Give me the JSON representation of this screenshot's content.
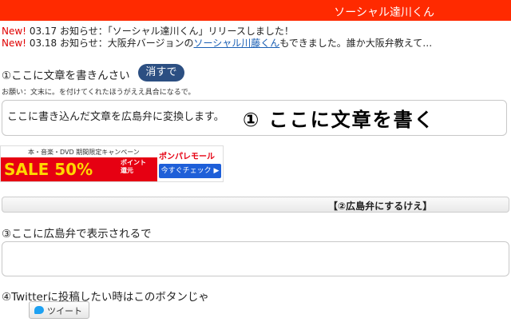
{
  "header": {
    "title": "ソーシャル達川くん"
  },
  "news": [
    {
      "badge": "New!",
      "text": "03.17 お知らせ：「ソーシャル達川くん」リリースしました！"
    },
    {
      "badge": "New!",
      "text_before": "03.18 お知らせ：大阪弁バージョンの",
      "link": "ソーシャル川藤くん",
      "text_after": "もできました。誰か大阪弁教えて…"
    }
  ],
  "input_section": {
    "title": "①ここに文章を書きんさい",
    "clear_button": "消すで",
    "note": "お願い：文末に。を付けてくれたほうがええ具合になるで。",
    "input_value": "ここに書き込んだ文章を広島弁に変換します。",
    "overlay_text": "① ここに文章を書く"
  },
  "ad": {
    "top_text": "本・音楽・DVD 期間限定キャンペーン",
    "sale_text": "SALE 50%",
    "sale_sub": "ポイント還元",
    "logo": "ポンパレモール",
    "button": "今すぐチェック ▶"
  },
  "convert": {
    "button": "【②広島弁にするけえ】"
  },
  "output_section": {
    "title": "③ここに広島弁で表示されるで",
    "value": ""
  },
  "tweet_section": {
    "title": "④Twitterに投稿したい時はこのボタンじゃ",
    "button": "ツイート"
  },
  "colors": {
    "header_bg": "#ff2a00",
    "clear_button_bg": "#2c4f82",
    "link": "#1a5fb4",
    "new_badge": "#e00000"
  }
}
